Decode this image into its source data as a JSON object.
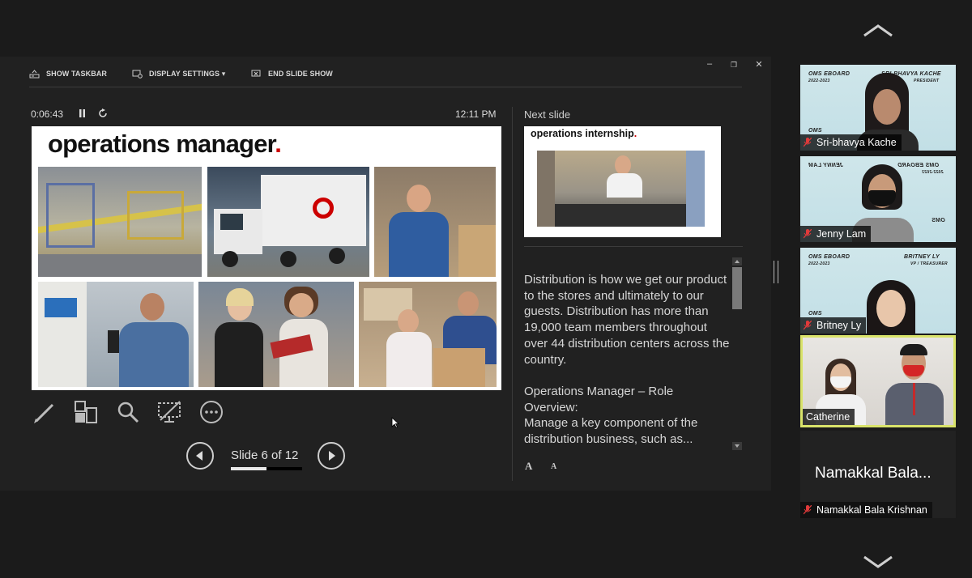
{
  "toolbar": {
    "show_taskbar": "SHOW TASKBAR",
    "display_settings": "DISPLAY SETTINGS ▾",
    "end_slide_show": "END SLIDE SHOW"
  },
  "window_controls": {
    "minimize": "–",
    "restore": "❐",
    "close": "✕"
  },
  "presenter": {
    "timer": "0:06:43",
    "clock": "12:11 PM",
    "slide_counter": "Slide 6 of 12",
    "progress_fraction": 0.5
  },
  "current_slide": {
    "title": "operations manager",
    "title_dot": "."
  },
  "next_slide": {
    "label": "Next slide",
    "title": "operations internship",
    "title_dot": "."
  },
  "notes": {
    "paragraphs": [
      "Distribution is how we get our product to the stores and ultimately to our guests. Distribution has more than 19,000 team members throughout over 44 distribution centers across the country.",
      "Operations Manager – Role Overview:\nManage a key component of the distribution business, such as..."
    ],
    "font_controls": [
      "A",
      "A"
    ]
  },
  "participants": [
    {
      "name": "Sri-bhavya Kache",
      "muted": true,
      "board_left": "OMS EBOARD",
      "board_left_sub": "2022-2023",
      "board_right": "SRI-BHAVYA KACHE",
      "board_right_sub": "PRESIDENT",
      "board_bottom": "OMS"
    },
    {
      "name": "Jenny Lam",
      "muted": true,
      "board_left": "JENNY LAM",
      "board_left_sub": "",
      "board_right": "OMS EBOARD",
      "board_right_sub": "2022-2023",
      "board_bottom": "OMS"
    },
    {
      "name": "Britney Ly",
      "muted": true,
      "board_left": "OMS EBOARD",
      "board_left_sub": "2022-2023",
      "board_right": "BRITNEY LY",
      "board_right_sub": "VP / TREASURER",
      "board_bottom": "OMS"
    },
    {
      "name": "Catherine",
      "muted": false
    },
    {
      "name": "Namakkal Bala Krishnan",
      "display": "Namakkal Bala...",
      "muted": true
    }
  ],
  "colors": {
    "background": "#1b1b1b",
    "presenter_bg": "#212121",
    "active_speaker_border": "#d9e36a",
    "brand_red": "#cc0000",
    "mic_muted": "#e03a3a"
  },
  "icons": [
    "chevron-up-icon",
    "chevron-down-icon",
    "pen-icon",
    "slides-grid-icon",
    "zoom-icon",
    "black-screen-icon",
    "more-icon",
    "prev-icon",
    "next-icon",
    "pause-icon",
    "reset-icon",
    "mic-muted-icon"
  ]
}
